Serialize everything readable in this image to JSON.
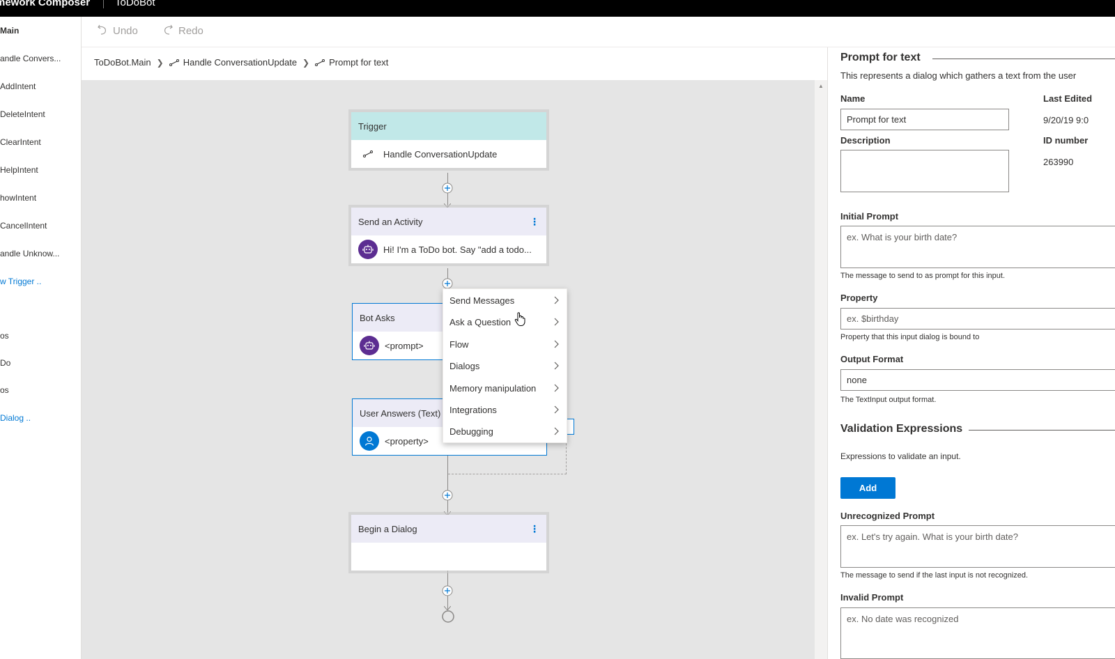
{
  "topbar": {
    "app_title": "mework Composer",
    "bot_name": "ToDoBot"
  },
  "leftnav": {
    "items": [
      {
        "label": "Main",
        "style": "first"
      },
      {
        "label": "andle Convers...",
        "style": "normal"
      },
      {
        "label": "AddIntent",
        "style": "normal"
      },
      {
        "label": "DeleteIntent",
        "style": "normal"
      },
      {
        "label": "ClearIntent",
        "style": "normal"
      },
      {
        "label": "HelpIntent",
        "style": "normal"
      },
      {
        "label": "howIntent",
        "style": "normal"
      },
      {
        "label": "CancelIntent",
        "style": "normal"
      },
      {
        "label": "andle Unknow...",
        "style": "normal"
      },
      {
        "label": "w Trigger ..",
        "style": "link"
      },
      {
        "label": "",
        "style": "normal"
      },
      {
        "label": "os",
        "style": "normal"
      },
      {
        "label": "Do",
        "style": "normal"
      },
      {
        "label": "os",
        "style": "normal"
      },
      {
        "label": "Dialog ..",
        "style": "link"
      }
    ]
  },
  "toolbar": {
    "undo_label": "Undo",
    "redo_label": "Redo"
  },
  "breadcrumb": {
    "root": "ToDoBot.Main",
    "trigger": "Handle ConversationUpdate",
    "current": "Prompt for text"
  },
  "canvas": {
    "trigger_node": {
      "header": "Trigger",
      "body": "Handle ConversationUpdate"
    },
    "send_activity": {
      "header": "Send an Activity",
      "body": "Hi! I'm a ToDo bot. Say \"add a todo..."
    },
    "bot_asks": {
      "header": "Bot Asks",
      "body": "<prompt>"
    },
    "user_answers": {
      "header": "User Answers (Text)",
      "body": "<property>"
    },
    "begin_dialog": {
      "header": "Begin a Dialog",
      "body": ""
    }
  },
  "context_menu": {
    "items": [
      "Send Messages",
      "Ask a Question",
      "Flow",
      "Dialogs",
      "Memory manipulation",
      "Integrations",
      "Debugging"
    ]
  },
  "panel": {
    "title": "Prompt for text",
    "description": "This represents a dialog which gathers a text from the user",
    "name_label": "Name",
    "name_value": "Prompt for text",
    "last_edited_label": "Last Edited",
    "last_edited_value": "9/20/19 9:0",
    "description_label": "Description",
    "id_label": "ID number",
    "id_value": "263990",
    "initial_prompt_label": "Initial Prompt",
    "initial_prompt_placeholder": "ex. What is your birth date?",
    "initial_prompt_hint": "The message to send to as prompt for this input.",
    "property_label": "Property",
    "property_placeholder": "ex. $birthday",
    "property_hint": "Property that this input dialog is bound to",
    "output_format_label": "Output Format",
    "output_format_value": "none",
    "output_format_hint": "The TextInput output format.",
    "validation_title": "Validation Expressions",
    "validation_hint": "Expressions to validate an input.",
    "add_label": "Add",
    "unrecognized_label": "Unrecognized Prompt",
    "unrecognized_placeholder": "ex. Let's try again. What is your birth date?",
    "unrecognized_hint": "The message to send if the last input is not recognized.",
    "invalid_label": "Invalid Prompt",
    "invalid_placeholder": "ex. No date was recognized"
  },
  "colors": {
    "trigger_header": "#c1e8e8",
    "activity_header": "#ecebf6",
    "accent": "#0078d4",
    "bot_avatar": "#5c2d91",
    "canvas_bg": "#e5e5e5"
  },
  "icons": [
    "undo-icon",
    "redo-icon",
    "chevron-right-icon",
    "trigger-icon",
    "bot-icon",
    "user-icon",
    "more-icon",
    "add-icon",
    "pointer-hand-icon"
  ]
}
